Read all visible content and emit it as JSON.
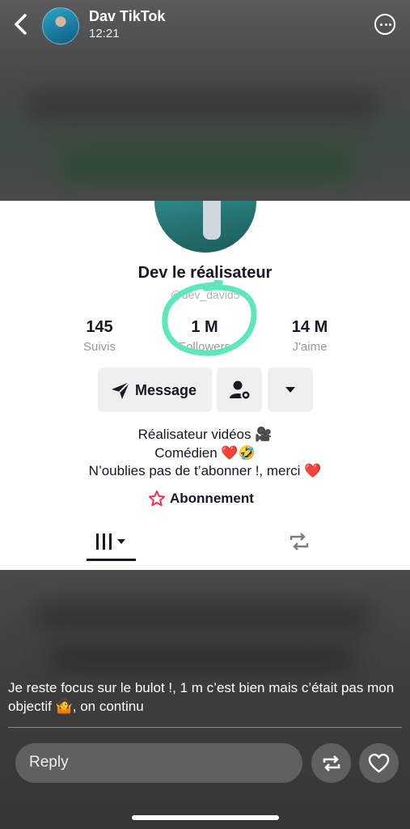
{
  "story": {
    "user_name": "Dav TikTok",
    "time": "12:21",
    "caption": "Je reste focus sur le bulot !, 1 m c’est bien mais c’était pas mon objectif 🤷, on continu",
    "reply_placeholder": "Reply"
  },
  "profile": {
    "name": "Dev le réalisateur",
    "handle": "@dev_david5",
    "stats": [
      {
        "value": "145",
        "label": "Suivis"
      },
      {
        "value": "1 M",
        "label": "Followers"
      },
      {
        "value": "14 M",
        "label": "J'aime"
      }
    ],
    "message_label": "Message",
    "bio": [
      "Réalisateur vidéos 🎥",
      "Comédien ❤️🤣",
      "N’oublies pas de t’abonner !, merci ❤️"
    ],
    "subscribe_label": "Abonnement"
  },
  "colors": {
    "highlight": "#5de8b8",
    "subscribe_accent": "#fe2c55"
  },
  "icons": [
    "back-chevron-icon",
    "more-options-icon",
    "send-icon",
    "add-friend-gear-icon",
    "dropdown-arrow-icon",
    "star-icon",
    "grid-icon",
    "repost-icon",
    "share-icon",
    "heart-icon"
  ]
}
